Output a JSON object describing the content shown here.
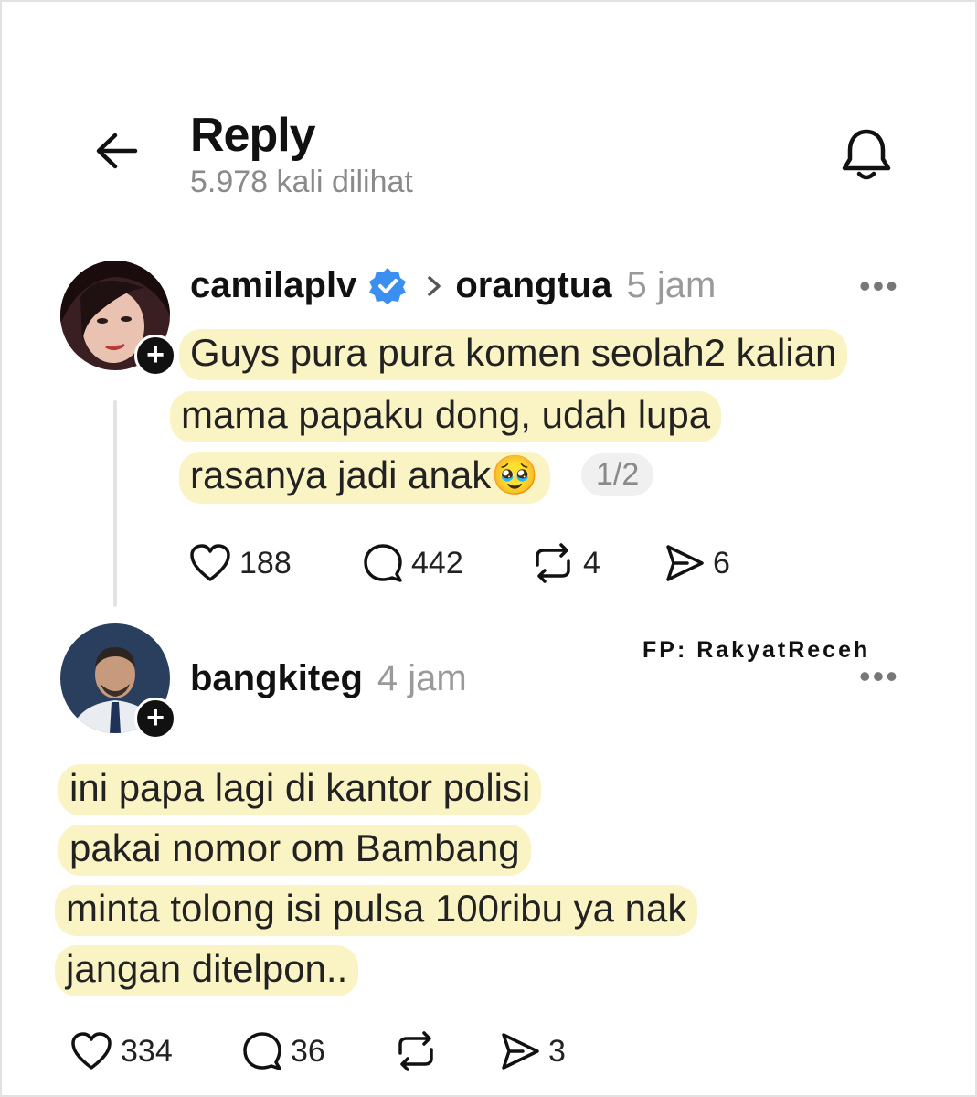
{
  "header": {
    "title": "Reply",
    "views": "5.978 kali dilihat"
  },
  "post1": {
    "username": "camilaplv",
    "verified": true,
    "reply_target": "orangtua",
    "time": "5 jam",
    "lines": [
      "Guys pura pura komen seolah2 kalian",
      "mama papaku dong, udah lupa",
      "rasanya jadi anak"
    ],
    "emoji": "🥹",
    "page": "1/2",
    "likes": "188",
    "comments": "442",
    "reposts": "4",
    "shares": "6"
  },
  "post2": {
    "username": "bangkiteg",
    "time": "4 jam",
    "lines": [
      "ini papa lagi di kantor polisi",
      "pakai nomor om Bambang",
      "minta tolong isi pulsa 100ribu ya nak",
      "jangan ditelpon.."
    ],
    "likes": "334",
    "comments": "36",
    "reposts": "",
    "shares": "3"
  },
  "watermark": "FP: RakyatReceh",
  "colors": {
    "highlight": "#faf3c4",
    "verified": "#3b8ff0",
    "muted": "#8a8a8a"
  },
  "icons": [
    "back-arrow-icon",
    "bell-icon",
    "verified-icon",
    "heart-icon",
    "comment-icon",
    "repost-icon",
    "share-icon",
    "more-icon",
    "plus-icon"
  ]
}
